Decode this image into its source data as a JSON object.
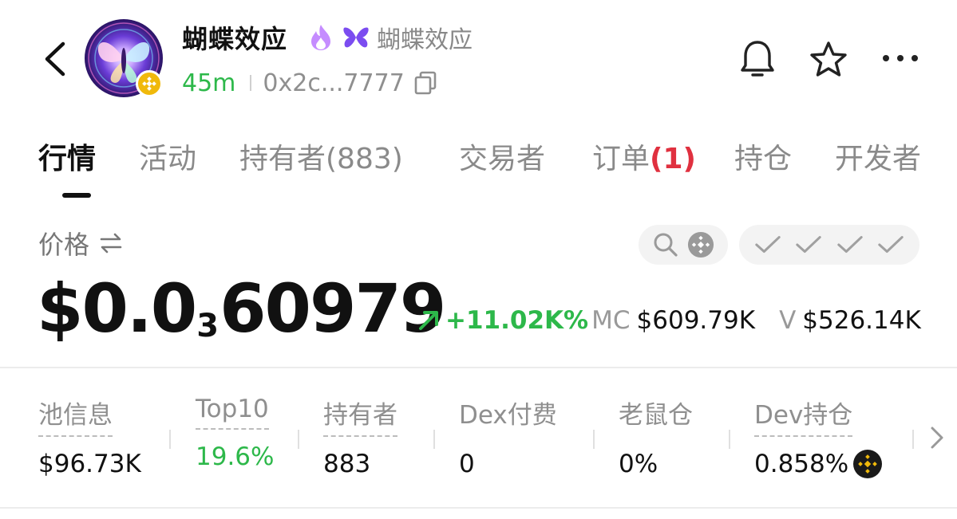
{
  "header": {
    "token_name": "蝴蝶效应",
    "token_tag": "蝴蝶效应",
    "age": "45m",
    "address": "0x2c...7777",
    "icons": {
      "back": "chevron-left-icon",
      "flame": "flame-icon",
      "butterfly": "butterfly-icon",
      "copy": "copy-icon",
      "bell": "bell-icon",
      "star": "star-icon",
      "more": "more-icon",
      "chain_badge": "bnb-chain-icon"
    }
  },
  "tabs": [
    {
      "label": "行情",
      "active": true
    },
    {
      "label": "活动"
    },
    {
      "label": "持有者(883)"
    },
    {
      "label": "交易者"
    },
    {
      "label": "订单",
      "badge": "(1)"
    },
    {
      "label": "持仓"
    },
    {
      "label": "开发者"
    }
  ],
  "price": {
    "label": "价格",
    "main": "$0.0",
    "zero_count": "3",
    "tail": "60979",
    "change": "+11.02K%",
    "mc_label": "MC",
    "mc_value": "$609.79K",
    "v_label": "V",
    "v_value": "$526.14K"
  },
  "info": [
    {
      "label": "池信息",
      "value": "$96.73K"
    },
    {
      "label": "Top10",
      "value": "19.6%"
    },
    {
      "label": "持有者",
      "value": "883"
    },
    {
      "label": "Dex付费",
      "value": "0"
    },
    {
      "label": "老鼠仓",
      "value": "0%"
    },
    {
      "label": "Dev持仓",
      "value": "0.858%"
    }
  ],
  "colors": {
    "green": "#2db84a",
    "red": "#e0303f",
    "purple": "#8a5cf6",
    "bnb_yellow": "#f0b90b"
  }
}
